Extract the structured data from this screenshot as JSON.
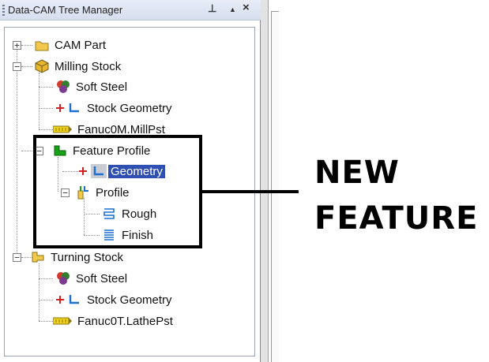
{
  "panel": {
    "title": "Data-CAM Tree Manager",
    "pin_glyph": "⊥",
    "minimize_glyph": "▲",
    "close_glyph": "×"
  },
  "tree": [
    {
      "label": "CAM Part",
      "icon": "folder-icon",
      "expander": "+"
    },
    {
      "label": "Milling Stock",
      "icon": "stock-box-icon",
      "expander": "−"
    },
    {
      "label": "Soft Steel",
      "icon": "material-icon"
    },
    {
      "label": "Stock Geometry",
      "icon": "geometry-icon"
    },
    {
      "label": "Fanuc0M.MillPst",
      "icon": "post-processor-icon"
    },
    {
      "label": "Feature Profile",
      "icon": "feature-profile-icon",
      "expander": "−"
    },
    {
      "label": "Geometry",
      "icon": "geometry-icon",
      "selected": true
    },
    {
      "label": "Profile",
      "icon": "profile-operation-icon",
      "expander": "−"
    },
    {
      "label": "Rough",
      "icon": "rough-toolpath-icon"
    },
    {
      "label": "Finish",
      "icon": "finish-toolpath-icon"
    },
    {
      "label": "Turning Stock",
      "icon": "turning-stock-icon",
      "expander": "−"
    },
    {
      "label": "Soft Steel",
      "icon": "material-icon"
    },
    {
      "label": "Stock Geometry",
      "icon": "geometry-icon"
    },
    {
      "label": "Fanuc0T.LathePst",
      "icon": "post-processor-icon"
    }
  ],
  "callout": {
    "line1": "NEW",
    "line2": "FEATURE"
  },
  "colors": {
    "selection": "#2f4fb3",
    "folder": "#f2c94c",
    "geometry": "#1b6fd1",
    "marker": "#d42020",
    "feature": "#17a317"
  }
}
